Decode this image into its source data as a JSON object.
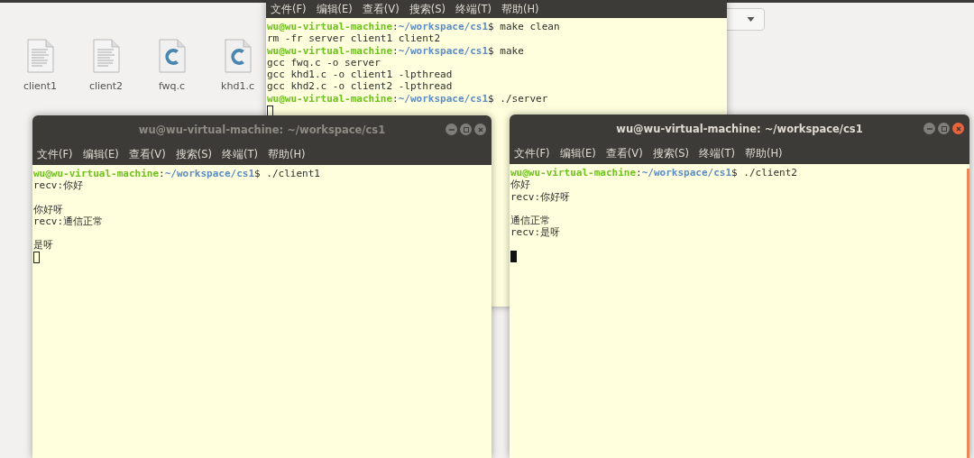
{
  "file_manager": {
    "files": [
      {
        "name": "client1",
        "kind": "text"
      },
      {
        "name": "client2",
        "kind": "text"
      },
      {
        "name": "fwq.c",
        "kind": "c"
      },
      {
        "name": "khd1.c",
        "kind": "c"
      }
    ]
  },
  "windows": [
    {
      "focused": false,
      "menu": [
        "文件(F)",
        "编辑(E)",
        "查看(V)",
        "搜索(S)",
        "终端(T)",
        "帮助(H)"
      ],
      "cursor_filled": false,
      "lines": [
        {
          "kind": "prompt",
          "user": "wu@wu-virtual-machine",
          "sep": ":",
          "path": "~/workspace/cs1",
          "command": "$ make clean"
        },
        {
          "kind": "output",
          "text": "rm -fr server client1 client2"
        },
        {
          "kind": "prompt",
          "user": "wu@wu-virtual-machine",
          "sep": ":",
          "path": "~/workspace/cs1",
          "command": "$ make"
        },
        {
          "kind": "output",
          "text": "gcc fwq.c -o server"
        },
        {
          "kind": "output",
          "text": "gcc khd1.c -o client1 -lpthread"
        },
        {
          "kind": "output",
          "text": "gcc khd2.c -o client2 -lpthread"
        },
        {
          "kind": "prompt",
          "user": "wu@wu-virtual-machine",
          "sep": ":",
          "path": "~/workspace/cs1",
          "command": "$ ./server"
        }
      ]
    },
    {
      "title": "wu@wu-virtual-machine: ~/workspace/cs1",
      "focused": false,
      "menu": [
        "文件(F)",
        "编辑(E)",
        "查看(V)",
        "搜索(S)",
        "终端(T)",
        "帮助(H)"
      ],
      "cursor_filled": false,
      "lines": [
        {
          "kind": "prompt",
          "user": "wu@wu-virtual-machine",
          "sep": ":",
          "path": "~/workspace/cs1",
          "command": "$ ./client1"
        },
        {
          "kind": "output",
          "text": "recv:你好"
        },
        {
          "kind": "blank"
        },
        {
          "kind": "output",
          "text": "你好呀"
        },
        {
          "kind": "output",
          "text": "recv:通信正常"
        },
        {
          "kind": "blank"
        },
        {
          "kind": "output",
          "text": "是呀"
        }
      ]
    },
    {
      "title": "wu@wu-virtual-machine: ~/workspace/cs1",
      "focused": true,
      "menu": [
        "文件(F)",
        "编辑(E)",
        "查看(V)",
        "搜索(S)",
        "终端(T)",
        "帮助(H)"
      ],
      "cursor_filled": true,
      "lines": [
        {
          "kind": "prompt",
          "user": "wu@wu-virtual-machine",
          "sep": ":",
          "path": "~/workspace/cs1",
          "command": "$ ./client2"
        },
        {
          "kind": "output",
          "text": "你好"
        },
        {
          "kind": "output",
          "text": "recv:你好呀"
        },
        {
          "kind": "blank"
        },
        {
          "kind": "output",
          "text": "通信正常"
        },
        {
          "kind": "output",
          "text": "recv:是呀"
        },
        {
          "kind": "blank"
        }
      ]
    }
  ]
}
